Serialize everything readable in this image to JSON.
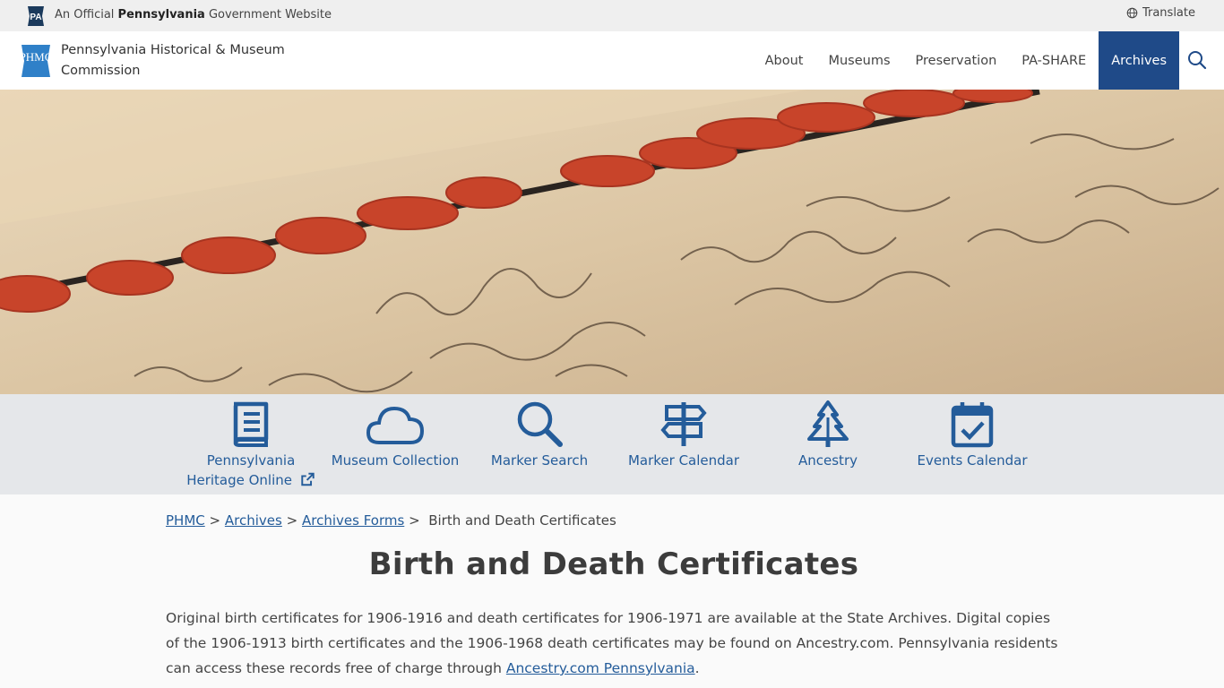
{
  "topbar": {
    "badge": "PA",
    "official_prefix": "An Official",
    "official_state": "Pennsylvania",
    "official_suffix": "Government Website",
    "translate_label": "Translate"
  },
  "header": {
    "logo_text": "PHMC",
    "org_name": "Pennsylvania Historical & Museum Commission",
    "nav": [
      {
        "label": "About"
      },
      {
        "label": "Museums"
      },
      {
        "label": "Preservation"
      },
      {
        "label": "PA-SHARE"
      },
      {
        "label": "Archives",
        "active": true
      }
    ]
  },
  "quick_links": [
    {
      "label": "Pennsylvania Heritage Online",
      "icon": "book-icon",
      "external": true
    },
    {
      "label": "Museum Collection",
      "icon": "cloud-icon"
    },
    {
      "label": "Marker Search",
      "icon": "search-icon"
    },
    {
      "label": "Marker Calendar",
      "icon": "signpost-icon"
    },
    {
      "label": "Ancestry",
      "icon": "tree-icon"
    },
    {
      "label": "Events Calendar",
      "icon": "calendar-check-icon"
    }
  ],
  "breadcrumb": [
    {
      "label": "PHMC",
      "link": true
    },
    {
      "label": "Archives",
      "link": true
    },
    {
      "label": "Archives Forms",
      "link": true
    },
    {
      "label": "Birth and Death Certificates",
      "link": false
    }
  ],
  "page": {
    "title": "Birth and Death Certificates",
    "para_text": "Original birth certificates for 1906-1916 and death certificates for 1906-1971 are available at the State Archives. Digital copies of the 1906-1913 birth certificates and the 1906-1968 death certificates may be found on Ancestry.com.  Pennsylvania residents can access these records free of charge through ",
    "para_link": "Ancestry.com Pennsylvania",
    "para_end": "."
  },
  "colors": {
    "accent": "#1f4a88",
    "link": "#245c9a",
    "wax": "#c8442a"
  }
}
